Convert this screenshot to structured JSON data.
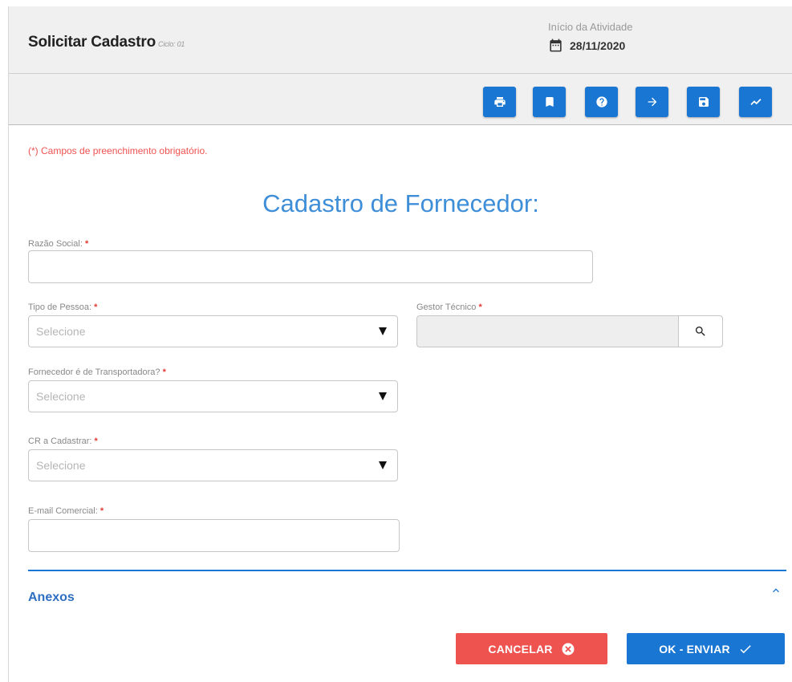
{
  "header": {
    "title": "Solicitar Cadastro",
    "cycle": "Ciclo: 01",
    "date_label": "Início da Atividade",
    "date_value": "28/11/2020"
  },
  "toolbar": {
    "buttons": [
      {
        "icon": "print-icon"
      },
      {
        "icon": "bookmark-icon"
      },
      {
        "icon": "help-icon"
      },
      {
        "icon": "arrow-right-icon"
      },
      {
        "icon": "save-icon"
      },
      {
        "icon": "trending-icon"
      }
    ],
    "color": "#1976d2"
  },
  "form": {
    "required_note": "(*) Campos de preenchimento obrigatório.",
    "heading": "Cadastro de Fornecedor:",
    "razao_social": {
      "label": "Razão Social:",
      "required": "*",
      "value": ""
    },
    "tipo_pessoa": {
      "label": "Tipo de Pessoa:",
      "required": "*",
      "value": "Selecione"
    },
    "gestor_tecnico": {
      "label": "Gestor Técnico",
      "required": "*",
      "value": ""
    },
    "transportadora": {
      "label": "Fornecedor é de Transportadora?",
      "required": "*",
      "value": "Selecione"
    },
    "cr_cadastrar": {
      "label": "CR a Cadastrar:",
      "required": "*",
      "value": "Selecione"
    },
    "email_comercial": {
      "label": "E-mail Comercial:",
      "required": "*",
      "value": ""
    }
  },
  "anexos": {
    "label": "Anexos"
  },
  "actions": {
    "cancel_label": "CANCELAR",
    "ok_label": "OK - ENVIAR",
    "cancel_color": "#ef5350",
    "ok_color": "#1976d2"
  }
}
